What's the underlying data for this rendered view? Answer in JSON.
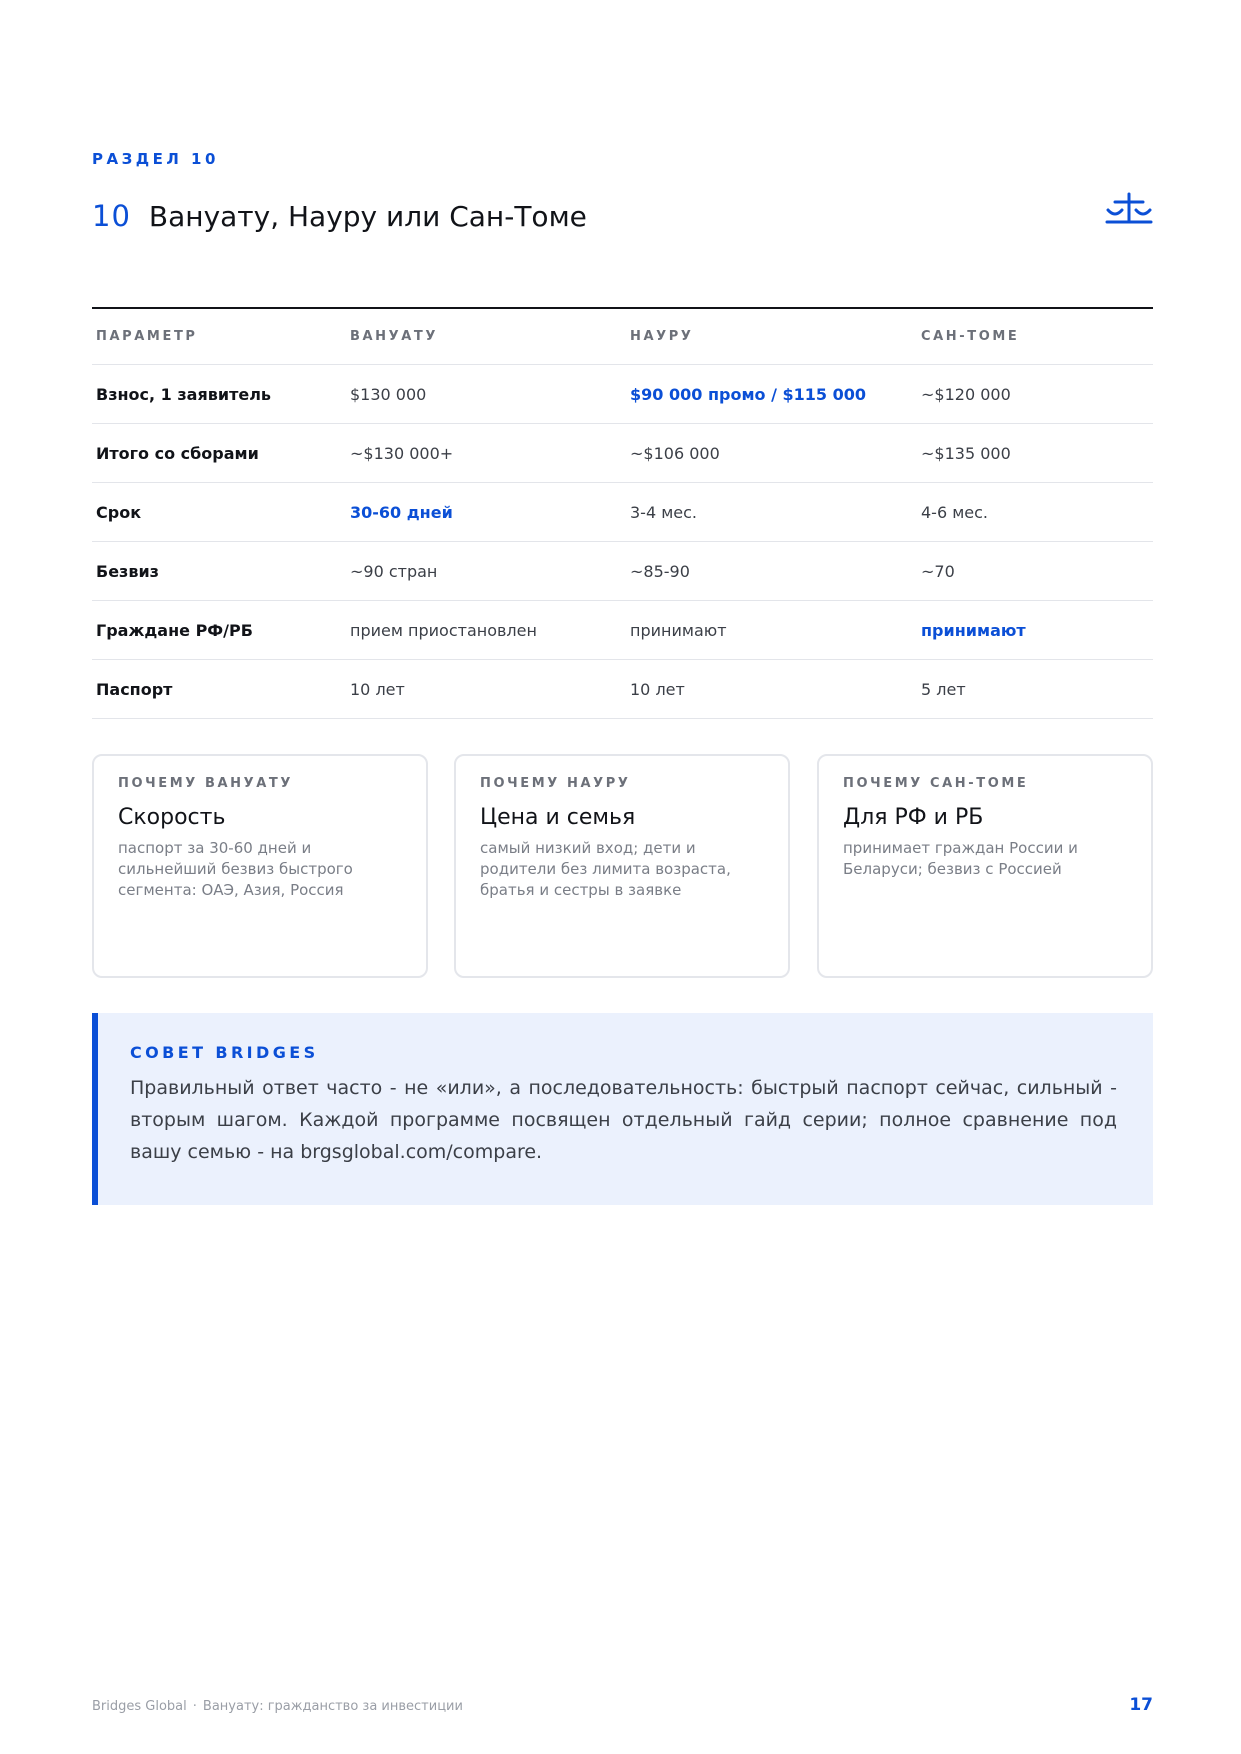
{
  "section": {
    "kicker": "РАЗДЕЛ 10",
    "number": "10",
    "title": "Вануату, Науру или Сан-Томе",
    "icon": "scale-icon"
  },
  "table": {
    "headers": [
      "ПАРАМЕТР",
      "ВАНУАТУ",
      "НАУРУ",
      "САН-ТОМЕ"
    ],
    "rows": [
      [
        "Взнос, 1 заявитель",
        "$130 000",
        "$90 000 промо / $115 000",
        "~$120 000"
      ],
      [
        "Итого со сборами",
        "~$130 000+",
        "~$106 000",
        "~$135 000"
      ],
      [
        "Срок",
        "30-60 дней",
        "3-4 мес.",
        "4-6 мес."
      ],
      [
        "Безвиз",
        "~90 стран",
        "~85-90",
        "~70"
      ],
      [
        "Граждане РФ/РБ",
        "прием приостановлен",
        "принимают",
        "принимают"
      ],
      [
        "Паспорт",
        "10 лет",
        "10 лет",
        "5 лет"
      ]
    ]
  },
  "cards": [
    {
      "kicker": "ПОЧЕМУ ВАНУАТУ",
      "title": "Скорость",
      "text": "паспорт за 30-60 дней и сильнейший безвиз быстрого сегмента: ОАЭ, Азия, Россия"
    },
    {
      "kicker": "ПОЧЕМУ НАУРУ",
      "title": "Цена и семья",
      "text": "самый низкий вход; дети и родители без лимита возраста, братья и сестры в заявке"
    },
    {
      "kicker": "ПОЧЕМУ САН-ТОМЕ",
      "title": "Для РФ и РБ",
      "text": "принимает граждан России и Беларуси; безвиз с Россией"
    }
  ],
  "advice": {
    "kicker": "СОВЕТ BRIDGES",
    "text": "Правильный ответ часто - не «или», а последовательность: быстрый паспорт сейчас, сильный - вторым шагом. Каждой программе посвящен отдельный гайд серии; полное сравнение под вашу семью - на brgsglobal.com/compare."
  },
  "footer": {
    "brand": "Bridges Global",
    "separator": "·",
    "doc_title": "Вануату: гражданство за инвестиции",
    "page": "17"
  },
  "colors": {
    "accent": "#0b4fd6",
    "advice_bg": "#ebf1fd",
    "text": "#111318",
    "muted": "#6c7079"
  }
}
